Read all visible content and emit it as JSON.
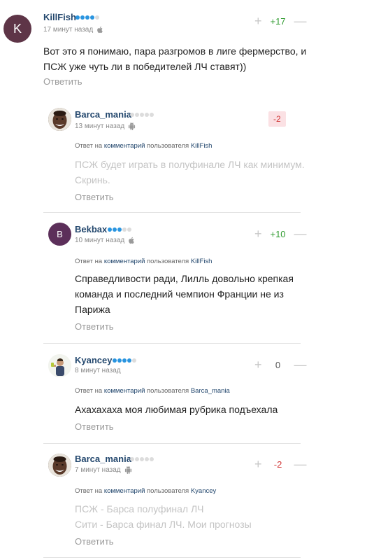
{
  "comments": [
    {
      "avatar_letter": "K",
      "avatar_color": "#5e3547",
      "username": "KillFish",
      "rating_dots_on": 4,
      "time": "17 минут назад",
      "os": "apple-icon",
      "score": "+17",
      "text_lines": [
        "Вот это я понимаю, пара разгромов в лиге фермерство, и",
        "ПСЖ уже чуть ли в победителей ЛЧ ставят))"
      ],
      "reply_label": "Ответить"
    },
    {
      "avatar_letter": "",
      "username": "Barca_mania",
      "rating_dots_on": 0,
      "time": "13 минут назад",
      "os": "android-icon",
      "score": "-2",
      "reply_to": {
        "prefix": "Ответ на",
        "link": "комментарий",
        "mid": "пользователя",
        "user": "KillFish"
      },
      "text_lines": [
        "ПСЖ будет играть в полуфинале ЛЧ как минимум.",
        "Скринь."
      ],
      "reply_label": "Ответить"
    },
    {
      "avatar_letter": "B",
      "avatar_color": "#5c2f5a",
      "username": "Bekbax",
      "rating_dots_on": 3,
      "time": "10 минут назад",
      "os": "apple-icon",
      "score": "+10",
      "reply_to": {
        "prefix": "Ответ на",
        "link": "комментарий",
        "mid": "пользователя",
        "user": "KillFish"
      },
      "text_lines": [
        "Справедливости ради, Лилль довольно крепкая",
        "команда и последний чемпион Франции не из",
        "Парижа"
      ],
      "reply_label": "Ответить"
    },
    {
      "avatar_letter": "",
      "username": "Kyancey",
      "rating_dots_on": 4,
      "time": "8 минут назад",
      "os": "",
      "score": "0",
      "reply_to": {
        "prefix": "Ответ на",
        "link": "комментарий",
        "mid": "пользователя",
        "user": "Barca_mania"
      },
      "text_lines": [
        "Ахахахаха моя любимая рубрика подъехала"
      ],
      "reply_label": "Ответить"
    },
    {
      "avatar_letter": "",
      "username": "Barca_mania",
      "rating_dots_on": 0,
      "time": "7 минут назад",
      "os": "android-icon",
      "score": "-2",
      "reply_to": {
        "prefix": "Ответ на",
        "link": "комментарий",
        "mid": "пользователя",
        "user": "Kyancey"
      },
      "text_lines": [
        "ПСЖ - Барса полуфинал ЛЧ",
        "Сити - Барса финал ЛЧ. Мои прогнозы"
      ],
      "reply_label": "Ответить"
    }
  ],
  "colors": {
    "link": "#24486e",
    "positive": "#2f9a2f",
    "negative": "#d23a3a",
    "dot_on": "#2a95e0"
  }
}
